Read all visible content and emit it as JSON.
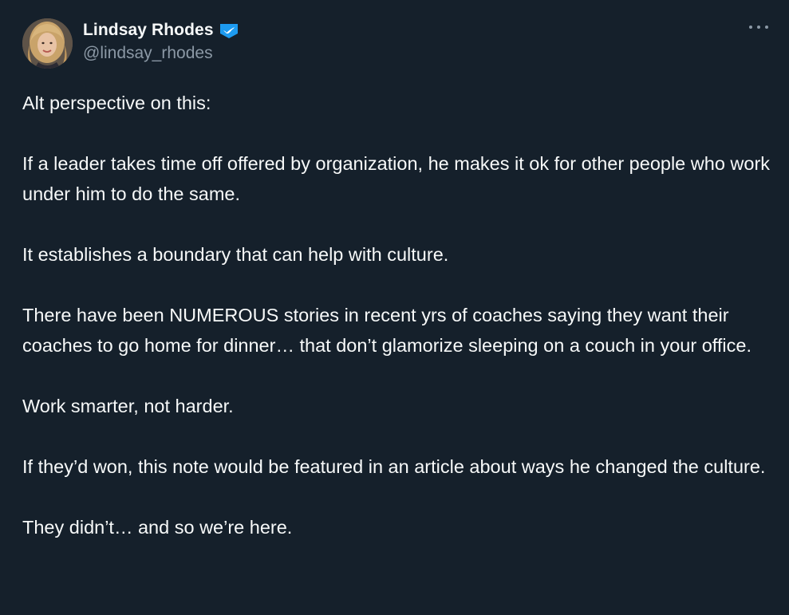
{
  "author": {
    "display_name": "Lindsay Rhodes",
    "handle": "@lindsay_rhodes",
    "verified": true
  },
  "colors": {
    "background": "#15202b",
    "text": "#f7f9f9",
    "secondary_text": "#8b98a5",
    "verified_badge": "#1d9bf0"
  },
  "icons": {
    "verified": "verified-badge-icon",
    "more": "more-options-icon"
  },
  "tweet": {
    "paragraphs": [
      "Alt perspective on this:",
      "If a leader takes time off offered by organization, he makes it ok for other people who work under him to do the same.",
      "It establishes a boundary that can help with culture.",
      "There have been NUMEROUS stories in recent yrs of coaches saying they want their coaches to go home for dinner… that don’t glamorize sleeping on a couch in your office.",
      "Work smarter, not harder.",
      "If they’d won, this note would be featured in an article about ways he changed the culture.",
      "They didn’t… and so we’re here."
    ]
  }
}
